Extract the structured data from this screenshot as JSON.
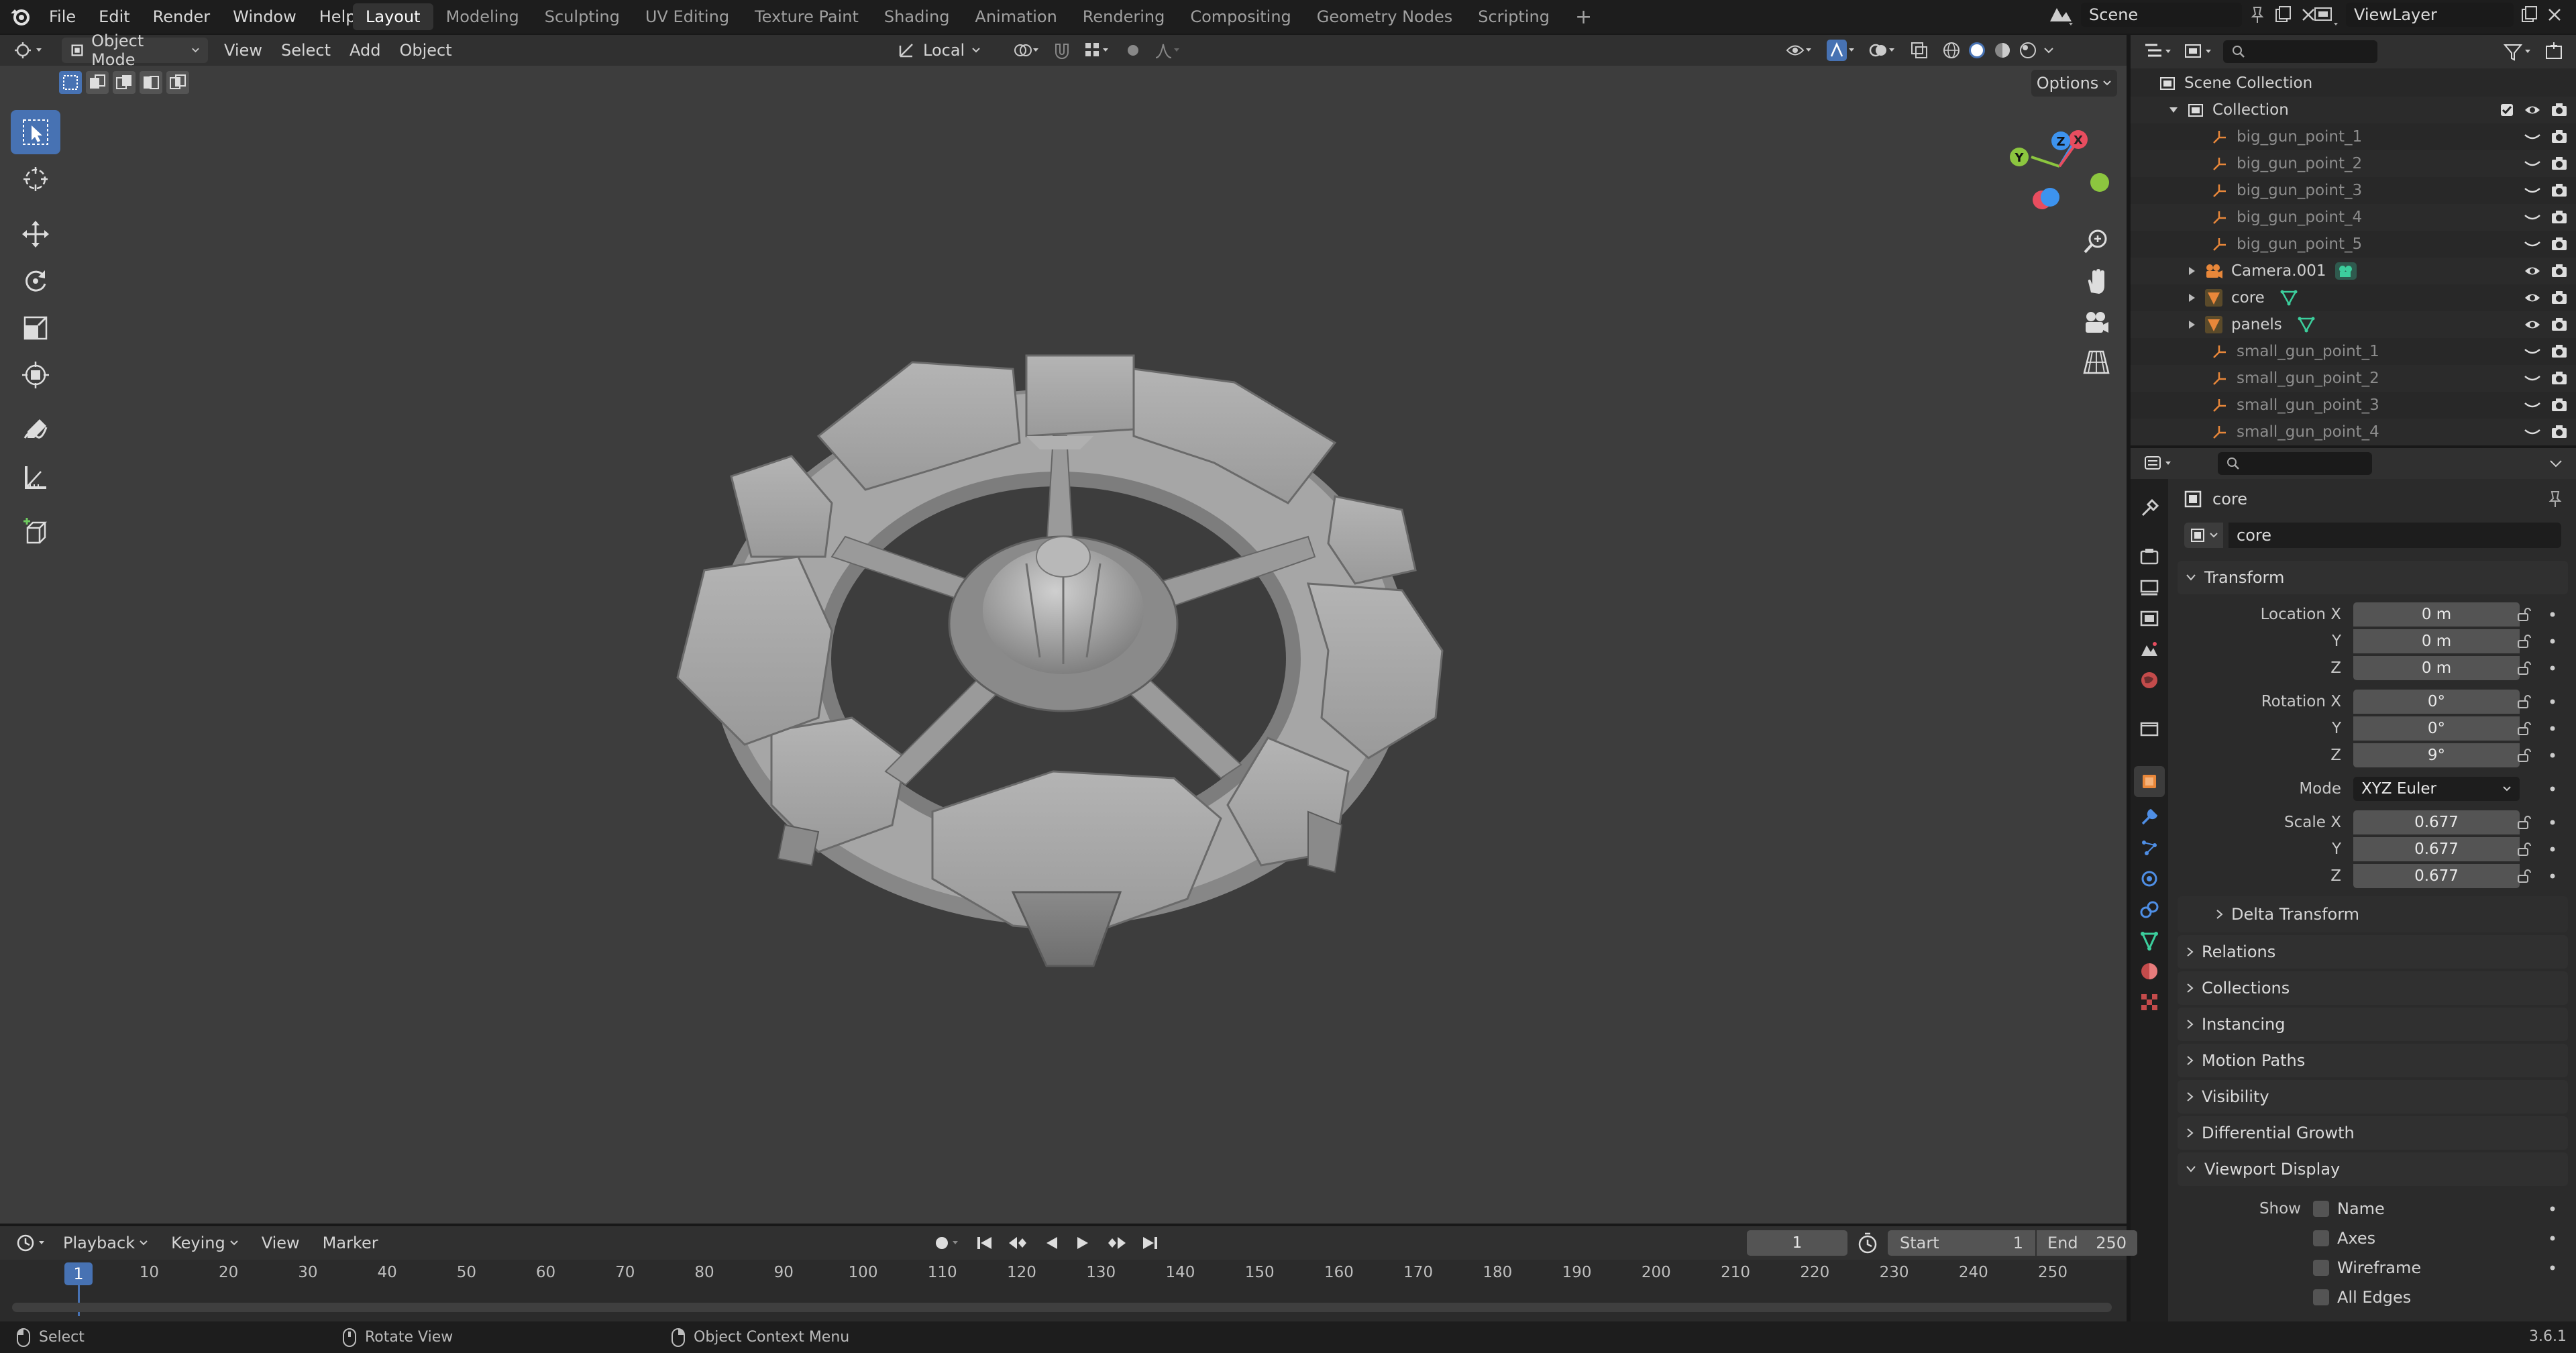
{
  "topbar": {
    "menus": [
      "File",
      "Edit",
      "Render",
      "Window",
      "Help"
    ],
    "workspace_tabs": [
      "Layout",
      "Modeling",
      "Sculpting",
      "UV Editing",
      "Texture Paint",
      "Shading",
      "Animation",
      "Rendering",
      "Compositing",
      "Geometry Nodes",
      "Scripting"
    ],
    "active_tab": "Layout",
    "add_tab": "+",
    "scene": "Scene",
    "view_layer": "ViewLayer"
  },
  "viewport_header": {
    "mode": "Object Mode",
    "menus": [
      "View",
      "Select",
      "Add",
      "Object"
    ],
    "transform_orientation": "Local",
    "options": "Options"
  },
  "outliner": {
    "scene_collection": "Scene Collection",
    "collection": "Collection",
    "items": [
      {
        "name": "big_gun_point_1",
        "type": "empty",
        "dim": true
      },
      {
        "name": "big_gun_point_2",
        "type": "empty",
        "dim": true
      },
      {
        "name": "big_gun_point_3",
        "type": "empty",
        "dim": true
      },
      {
        "name": "big_gun_point_4",
        "type": "empty",
        "dim": true
      },
      {
        "name": "big_gun_point_5",
        "type": "empty",
        "dim": true
      },
      {
        "name": "Camera.001",
        "type": "camera",
        "dim": false
      },
      {
        "name": "core",
        "type": "mesh",
        "dim": false
      },
      {
        "name": "panels",
        "type": "mesh",
        "dim": false
      },
      {
        "name": "small_gun_point_1",
        "type": "empty",
        "dim": true
      },
      {
        "name": "small_gun_point_2",
        "type": "empty",
        "dim": true
      },
      {
        "name": "small_gun_point_3",
        "type": "empty",
        "dim": true
      },
      {
        "name": "small_gun_point_4",
        "type": "empty",
        "dim": true
      }
    ]
  },
  "properties": {
    "context_name": "core",
    "object_name": "core",
    "transform_label": "Transform",
    "location": {
      "label_x": "Location X",
      "x": "0 m",
      "y": "0 m",
      "z": "0 m"
    },
    "rotation": {
      "label_x": "Rotation X",
      "x": "0°",
      "y": "0°",
      "z": "9°"
    },
    "mode_label": "Mode",
    "mode": "XYZ Euler",
    "scale": {
      "label_x": "Scale X",
      "x": "0.677",
      "y": "0.677",
      "z": "0.677"
    },
    "axis_y": "Y",
    "axis_z": "Z",
    "delta_transform": "Delta Transform",
    "collapsed_panels": [
      "Relations",
      "Collections",
      "Instancing",
      "Motion Paths",
      "Visibility",
      "Differential Growth"
    ],
    "viewport_display": "Viewport Display",
    "show_label": "Show",
    "show_options": [
      "Name",
      "Axes",
      "Wireframe",
      "All Edges"
    ]
  },
  "timeline": {
    "menus": [
      "Playback",
      "Keying",
      "View",
      "Marker"
    ],
    "current_frame": "1",
    "start_label": "Start",
    "start": "1",
    "end_label": "End",
    "end": "250",
    "ticks": [
      "10",
      "20",
      "30",
      "40",
      "50",
      "60",
      "70",
      "80",
      "90",
      "100",
      "110",
      "120",
      "130",
      "140",
      "150",
      "160",
      "170",
      "180",
      "190",
      "200",
      "210",
      "220",
      "230",
      "240",
      "250"
    ],
    "playhead": "1"
  },
  "statusbar": {
    "select": "Select",
    "rotate": "Rotate View",
    "context_menu": "Object Context Menu",
    "version": "3.6.1"
  },
  "colors": {
    "accent": "#4772b3",
    "gizmo_x": "#e84d5f",
    "gizmo_y": "#8cc63f",
    "gizmo_z": "#3d93ef",
    "mesh": "#9e9e9e"
  }
}
